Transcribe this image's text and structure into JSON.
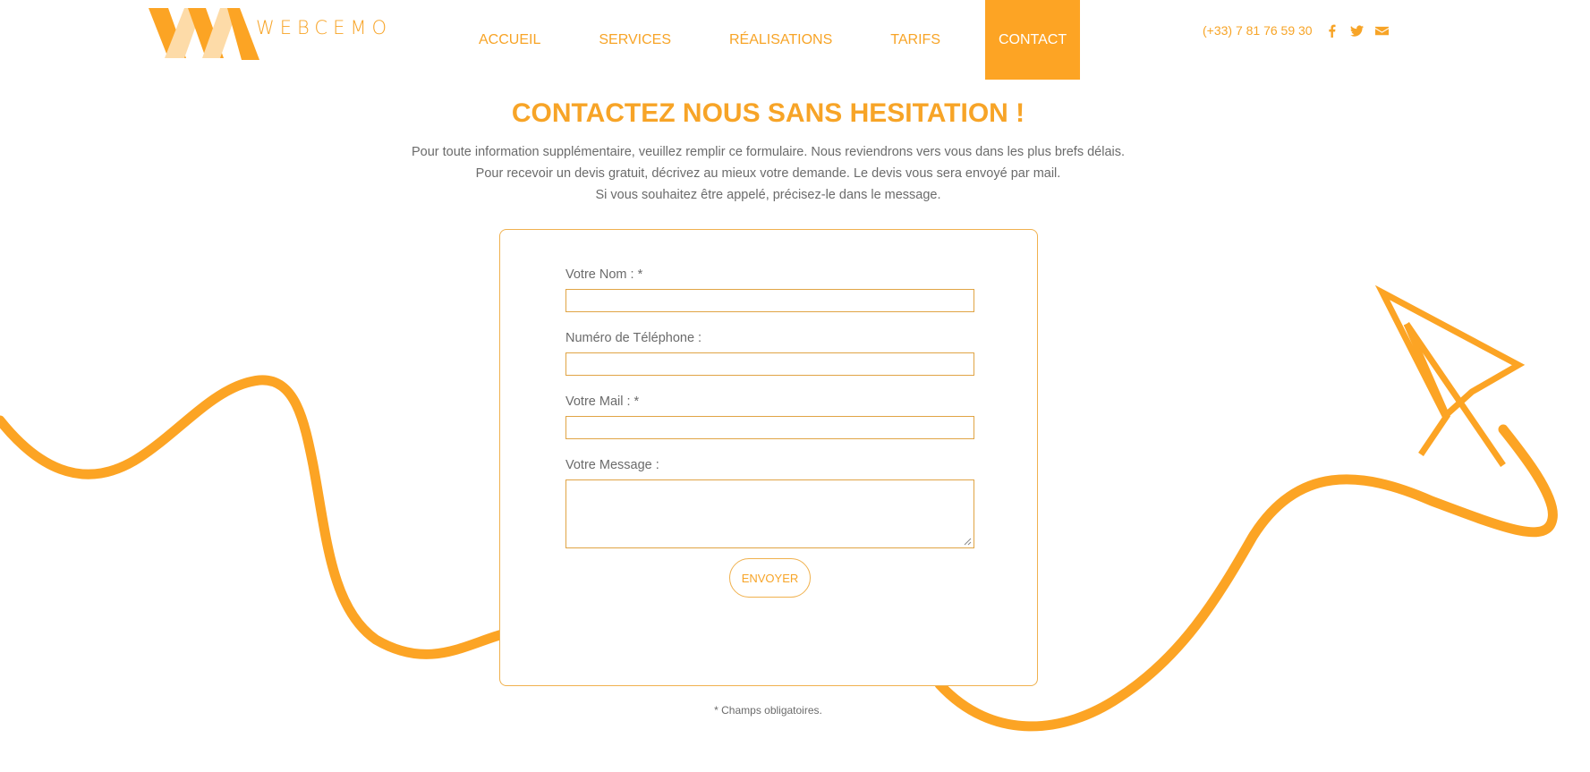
{
  "header": {
    "logo_text": "WEBCEMO",
    "nav": [
      {
        "label": "ACCUEIL"
      },
      {
        "label": "SERVICES"
      },
      {
        "label": "RÉALISATIONS"
      },
      {
        "label": "TARIFS"
      },
      {
        "label": "CONTACT",
        "active": true
      }
    ],
    "phone": "(+33) 7 81 76 59 30",
    "social_icons": [
      "facebook-icon",
      "twitter-icon",
      "envelope-icon"
    ]
  },
  "main": {
    "title": "CONTACTEZ NOUS SANS HESITATION !",
    "intro_lines": [
      "Pour toute information supplémentaire, veuillez remplir ce formulaire. Nous reviendrons vers vous dans les plus brefs délais.",
      "Pour recevoir un devis gratuit, décrivez au mieux votre demande. Le devis vous sera envoyé par mail.",
      "Si vous souhaitez être appelé, précisez-le dans le message."
    ]
  },
  "form": {
    "name_label": "Votre Nom : *",
    "name_value": "",
    "phone_label": "Numéro de Téléphone :",
    "phone_value": "",
    "mail_label": "Votre Mail : *",
    "mail_value": "",
    "message_label": "Votre Message :",
    "message_value": "",
    "submit_label": "ENVOYER"
  },
  "footnote": "* Champs obligatoires.",
  "colors": {
    "accent": "#f7a427",
    "accent_light": "#fddba8",
    "active_nav_bg": "#fda424",
    "text": "#6b6b6b"
  }
}
